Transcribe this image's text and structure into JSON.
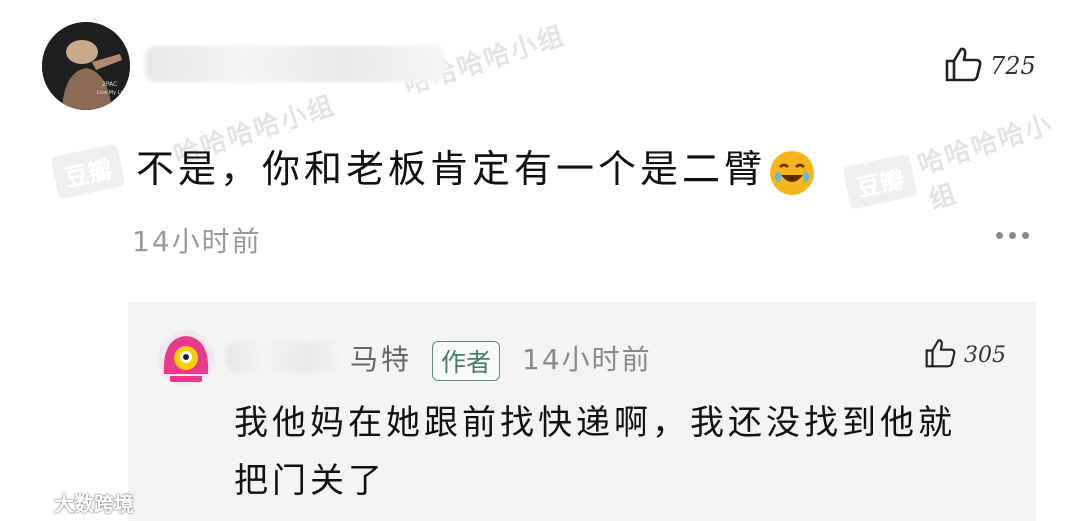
{
  "watermarks": {
    "badge_text": "豆瓣",
    "group_text": "哈哈哈哈小组"
  },
  "comment": {
    "likes": "725",
    "text": "不是，你和老板肯定有一个是二臂",
    "time": "14小时前"
  },
  "reply": {
    "name_visible": "马特",
    "author_badge": "作者",
    "time": "14小时前",
    "likes": "305",
    "text_line1": "我他妈在她跟前找快递啊，我还没找到他就",
    "text_line2": "把门关了"
  },
  "footer": {
    "brand": "大数跨境"
  },
  "icons": {
    "like": "thumbs-up-icon",
    "emoji": "laughing-emoji-icon",
    "more": "more-dots-icon"
  }
}
